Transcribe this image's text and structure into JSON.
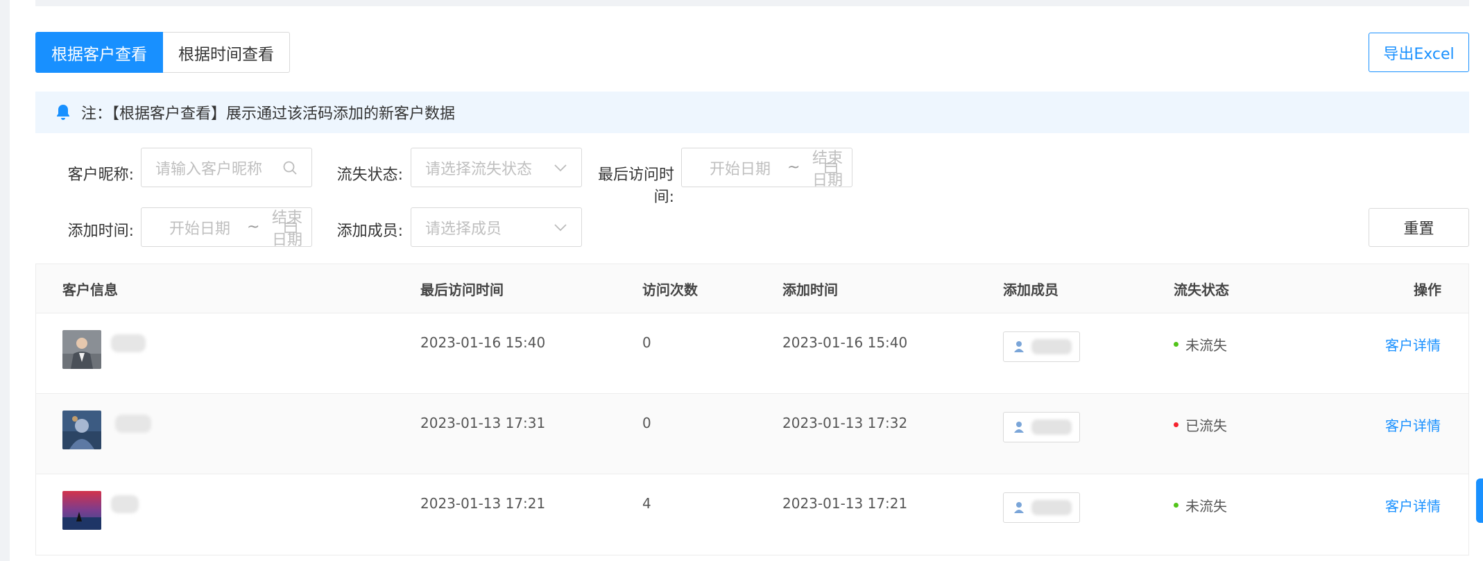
{
  "tabs": {
    "by_customer": "根据客户查看",
    "by_time": "根据时间查看"
  },
  "export_label": "导出Excel",
  "notice": "注：【根据客户查看】展示通过该活码添加的新客户数据",
  "filters": {
    "nickname_label": "客户昵称:",
    "nickname_placeholder": "请输入客户昵称",
    "churn_label": "流失状态:",
    "churn_placeholder": "请选择流失状态",
    "last_visit_label": "最后访问时间:",
    "add_time_label": "添加时间:",
    "member_label": "添加成员:",
    "member_placeholder": "请选择成员",
    "start_date": "开始日期",
    "end_date": "结束日期",
    "tilde": "~",
    "reset_label": "重置"
  },
  "table": {
    "headers": {
      "customer": "客户信息",
      "last_visit": "最后访问时间",
      "visits": "访问次数",
      "added": "添加时间",
      "member": "添加成员",
      "status": "流失状态",
      "actions": "操作"
    },
    "rows": [
      {
        "last_visit": "2023-01-16 15:40",
        "visits": "0",
        "added": "2023-01-16 15:40",
        "status": "未流失",
        "status_color": "#52c41a",
        "action": "客户详情"
      },
      {
        "last_visit": "2023-01-13 17:31",
        "visits": "0",
        "added": "2023-01-13 17:32",
        "status": "已流失",
        "status_color": "#f5222d",
        "action": "客户详情"
      },
      {
        "last_visit": "2023-01-13 17:21",
        "visits": "4",
        "added": "2023-01-13 17:21",
        "status": "未流失",
        "status_color": "#52c41a",
        "action": "客户详情"
      }
    ]
  },
  "colors": {
    "primary": "#1890ff"
  },
  "icons": [
    "bell-icon",
    "search-icon",
    "chevron-down-icon",
    "calendar-icon",
    "user-icon"
  ]
}
